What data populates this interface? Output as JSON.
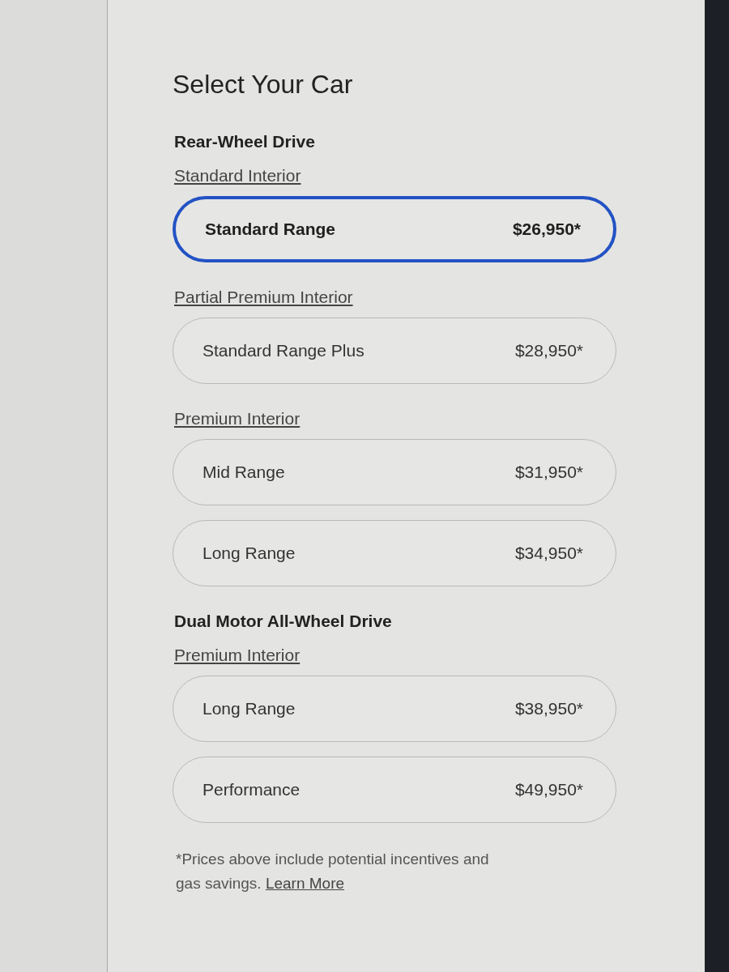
{
  "title": "Select Your Car",
  "drivetrains": [
    {
      "name": "Rear-Wheel Drive",
      "interiors": [
        {
          "label": "Standard Interior",
          "options": [
            {
              "name": "Standard Range",
              "price": "$26,950*",
              "selected": true
            }
          ]
        },
        {
          "label": "Partial Premium Interior",
          "options": [
            {
              "name": "Standard Range Plus",
              "price": "$28,950*",
              "selected": false
            }
          ]
        },
        {
          "label": "Premium Interior",
          "options": [
            {
              "name": "Mid Range",
              "price": "$31,950*",
              "selected": false
            },
            {
              "name": "Long Range",
              "price": "$34,950*",
              "selected": false
            }
          ]
        }
      ]
    },
    {
      "name": "Dual Motor All-Wheel Drive",
      "interiors": [
        {
          "label": "Premium Interior",
          "options": [
            {
              "name": "Long Range",
              "price": "$38,950*",
              "selected": false
            },
            {
              "name": "Performance",
              "price": "$49,950*",
              "selected": false
            }
          ]
        }
      ]
    }
  ],
  "footnote": {
    "text": "*Prices above include potential incentives and gas savings.",
    "link": "Learn More"
  }
}
